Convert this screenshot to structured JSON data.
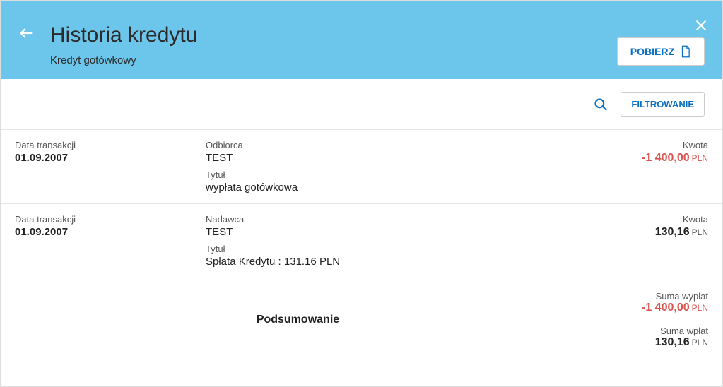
{
  "header": {
    "title": "Historia kredytu",
    "subtitle": "Kredyt gotówkowy",
    "download_label": "POBIERZ"
  },
  "toolbar": {
    "filter_label": "FILTROWANIE"
  },
  "labels": {
    "transaction_date": "Data transakcji",
    "recipient": "Odbiorca",
    "sender": "Nadawca",
    "title": "Tytuł",
    "amount": "Kwota",
    "summary": "Podsumowanie",
    "sum_payouts": "Suma wypłat",
    "sum_deposits": "Suma wpłat"
  },
  "transactions": [
    {
      "date": "01.09.2007",
      "party_label": "Odbiorca",
      "party": "TEST",
      "subject": "wypłata gotówkowa",
      "amount": "-1 400,00",
      "currency": "PLN",
      "negative": true
    },
    {
      "date": "01.09.2007",
      "party_label": "Nadawca",
      "party": "TEST",
      "subject": "Spłata Kredytu : 131.16 PLN",
      "amount": "130,16",
      "currency": "PLN",
      "negative": false
    }
  ],
  "summary": {
    "payouts_amount": "-1 400,00",
    "payouts_currency": "PLN",
    "deposits_amount": "130,16",
    "deposits_currency": "PLN"
  }
}
